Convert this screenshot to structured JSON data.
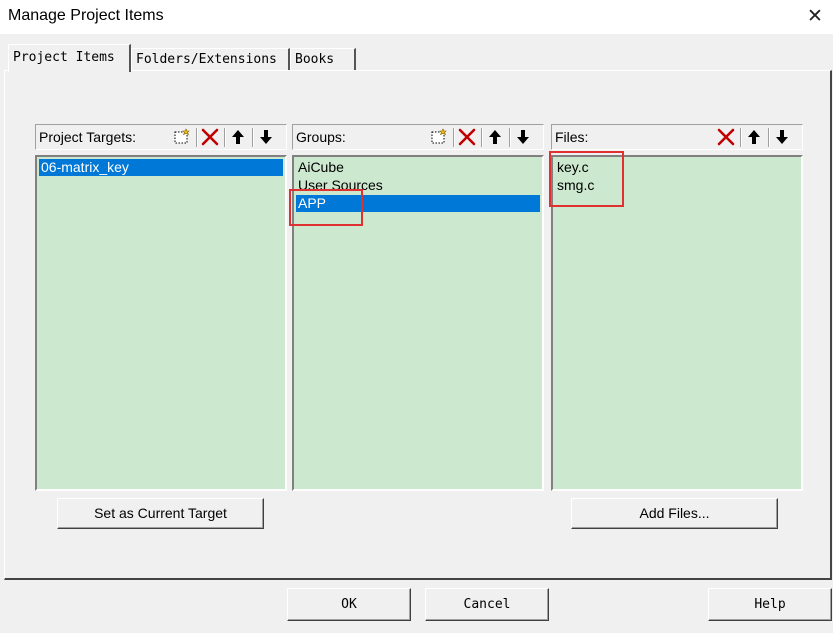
{
  "window": {
    "title": "Manage Project Items"
  },
  "tabs": [
    {
      "label": "Project Items",
      "active": true
    },
    {
      "label": "Folders/Extensions",
      "active": false
    },
    {
      "label": "Books",
      "active": false
    }
  ],
  "targets": {
    "label": "Project Targets:",
    "items": [
      "06-matrix_key"
    ],
    "selected": "06-matrix_key",
    "set_current_label": "Set as Current Target"
  },
  "groups": {
    "label": "Groups:",
    "items": [
      "AiCube",
      "User Sources",
      "APP"
    ],
    "selected": "APP"
  },
  "files": {
    "label": "Files:",
    "items": [
      "key.c",
      "smg.c"
    ],
    "add_files_label": "Add Files..."
  },
  "buttons": {
    "ok": "OK",
    "cancel": "Cancel",
    "help": "Help"
  },
  "icons": {
    "new": "new-item-icon",
    "delete": "delete-icon",
    "up": "move-up-icon",
    "down": "move-down-icon",
    "close": "close-icon"
  },
  "colors": {
    "list_background": "#cce8cf",
    "selection": "#0078d7",
    "highlight_box": "#e03030",
    "delete_icon": "#c00000"
  }
}
